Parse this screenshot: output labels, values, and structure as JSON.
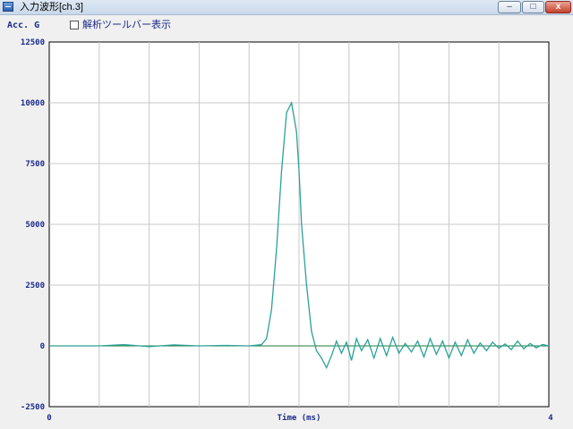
{
  "window": {
    "title": "入力波形[ch.3]",
    "buttons": {
      "minimize": "–",
      "maximize": "□",
      "close": "x"
    }
  },
  "toolbar": {
    "y_unit_label": "Acc. G",
    "analysis_toolbar_checkbox": {
      "label": "解析ツールバー表示",
      "checked": false
    }
  },
  "colors": {
    "signal": "#2aa198",
    "baseline": "#1d7a3a",
    "axis_text": "#1b2a8a",
    "grid": "#c8c8c8"
  },
  "chart_data": {
    "type": "line",
    "title": "",
    "xlabel": "Time (ms)",
    "ylabel": "Acc. G",
    "xlim": [
      0,
      4
    ],
    "ylim": [
      -2500,
      12500
    ],
    "x_tick_labels": [
      "0",
      "4"
    ],
    "y_tick_labels": [
      "12500",
      "10000",
      "7500",
      "5000",
      "2500",
      "0",
      "-2500"
    ],
    "grid": true,
    "series": [
      {
        "x": [
          0.0,
          0.4,
          0.6,
          0.8,
          1.0,
          1.2,
          1.4,
          1.6,
          1.7,
          1.74,
          1.78,
          1.82,
          1.86,
          1.9,
          1.94,
          1.98,
          2.0,
          2.02,
          2.06,
          2.1,
          2.14,
          2.18,
          2.22,
          2.26,
          2.3,
          2.34,
          2.38,
          2.42,
          2.46,
          2.5,
          2.55,
          2.6,
          2.65,
          2.7,
          2.75,
          2.8,
          2.85,
          2.9,
          2.95,
          3.0,
          3.05,
          3.1,
          3.15,
          3.2,
          3.25,
          3.3,
          3.35,
          3.4,
          3.45,
          3.5,
          3.55,
          3.6,
          3.65,
          3.7,
          3.75,
          3.8,
          3.85,
          3.9,
          3.95,
          4.0
        ],
        "y": [
          0,
          0,
          50,
          -30,
          40,
          0,
          20,
          0,
          50,
          300,
          1500,
          4000,
          7200,
          9600,
          10000,
          8800,
          7200,
          5000,
          2500,
          600,
          -200,
          -500,
          -900,
          -400,
          200,
          -300,
          150,
          -600,
          300,
          -200,
          250,
          -500,
          300,
          -400,
          350,
          -300,
          100,
          -250,
          200,
          -450,
          300,
          -350,
          200,
          -500,
          150,
          -400,
          250,
          -300,
          120,
          -200,
          150,
          -100,
          80,
          -150,
          200,
          -120,
          100,
          -80,
          60,
          0
        ]
      }
    ]
  }
}
